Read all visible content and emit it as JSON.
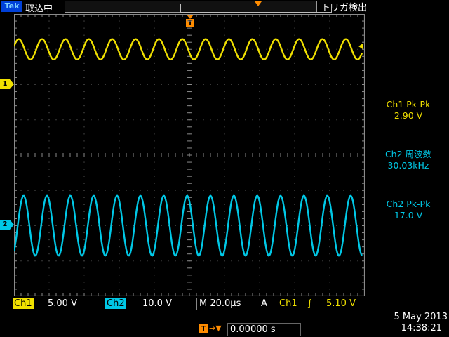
{
  "topbar": {
    "brand": "Tek",
    "status": "取込中",
    "trigger_status": "トリガ検出"
  },
  "trigger_marker": "T",
  "channels": [
    {
      "id": "ch1",
      "marker": "1",
      "color": "#f0e000",
      "amplitude_div": 0.29,
      "period_div": 0.666,
      "center_div": 1.0
    },
    {
      "id": "ch2",
      "marker": "2",
      "color": "#00c8e6",
      "amplitude_div": 0.85,
      "period_div": 0.666,
      "center_div": 6.0
    }
  ],
  "measurements": [
    {
      "label": "Ch1 Pk-Pk",
      "value": "2.90 V",
      "color": "#f0e000"
    },
    {
      "label": "Ch2 周波数",
      "value": "30.03kHz",
      "color": "#00c8e6"
    },
    {
      "label": "Ch2 Pk-Pk",
      "value": "17.0 V",
      "color": "#00c8e6"
    }
  ],
  "bottom": {
    "ch1_label": "Ch1",
    "ch1_scale": "5.00 V",
    "ch2_label": "Ch2",
    "ch2_scale": "10.0 V",
    "timebase": "M 20.0µs",
    "trigger_mode": "A",
    "trigger_source": "Ch1",
    "trigger_edge": "∫",
    "trigger_level": "5.10 V"
  },
  "horizontal_position": {
    "icon": "T",
    "arrow": "→▼",
    "value": "0.00000 s"
  },
  "datetime": {
    "date": "5 May 2013",
    "time": "14:38:21"
  }
}
